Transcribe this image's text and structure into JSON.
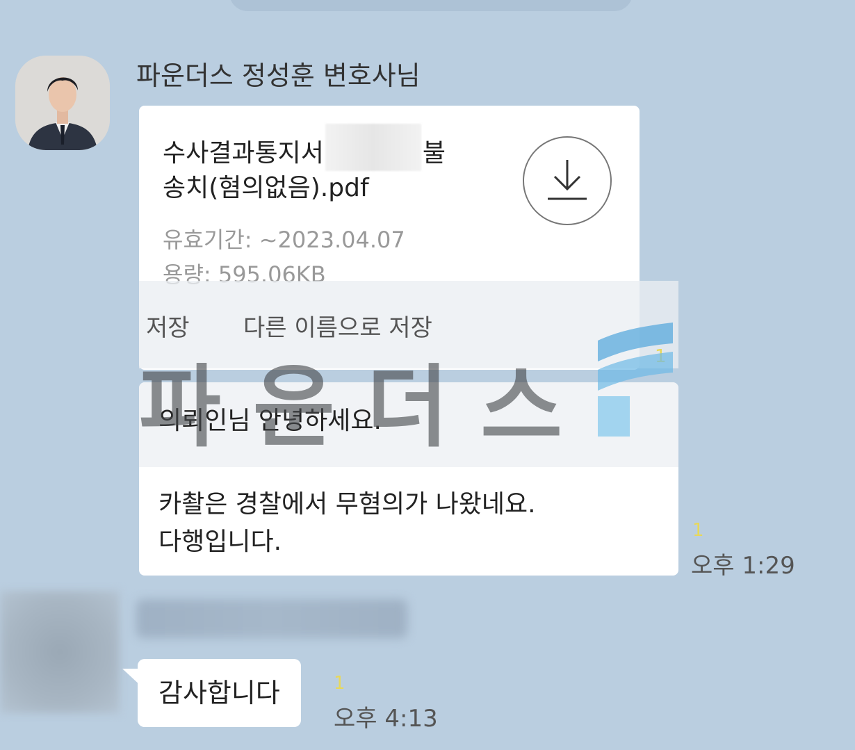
{
  "chat": {
    "sender_name": "파운더스 정성훈 변호사님",
    "file_message": {
      "file_name_part1": "수사결과통지서",
      "file_name_part2": "불",
      "file_name_line2": "송치(혐의없음).pdf",
      "expiry": "유효기간: ~2023.04.07",
      "size": "용량: 595.06KB",
      "actions": [
        "저장",
        "다른 이름으로 저장"
      ],
      "read_count": "1"
    },
    "text_message": {
      "line1": "의뢰인님 안녕하세요.",
      "line2": "카촬은 경찰에서 무혐의가 나왔네요.",
      "line3": "다행입니다.",
      "read_count": "1",
      "time": "오후 1:29"
    },
    "reply_message": {
      "text": "감사합니다",
      "read_count": "1",
      "time": "오후 4:13"
    }
  },
  "watermark": {
    "text": "파운더스"
  },
  "colors": {
    "background": "#bacee0",
    "bubble": "#ffffff",
    "read_count": "#e8d85a"
  }
}
